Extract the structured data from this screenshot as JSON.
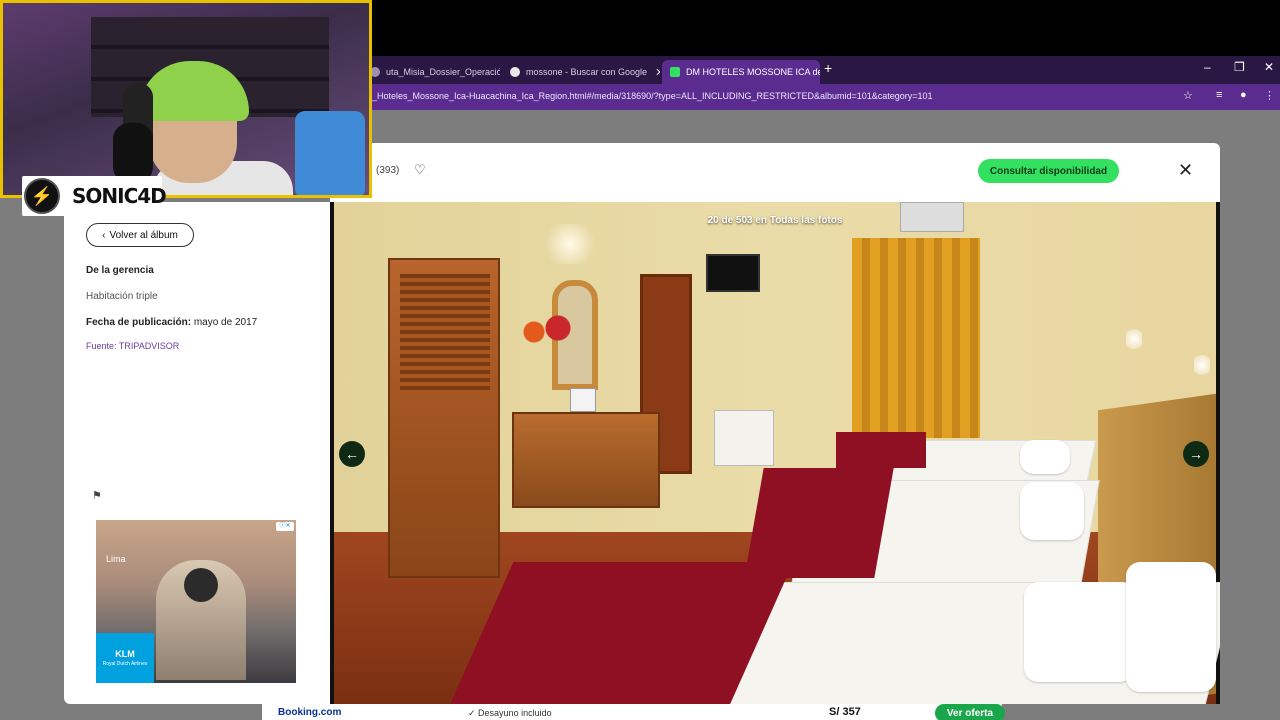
{
  "browser": {
    "tabs": [
      {
        "title": "uta_Misia_Dossier_Operación_",
        "icon_color": "#9a8fb0"
      },
      {
        "title": "mossone - Buscar con Google",
        "icon_color": "#e8e8e8"
      },
      {
        "title": "DM HOTELES MOSSONE ICA de",
        "icon_color": "#34e05f"
      }
    ],
    "new_tab": "+",
    "url": "_Hoteles_Mossone_Ica-Huacachina_Ica_Region.html#/media/318690/?type=ALL_INCLUDING_RESTRICTED&albumid=101&category=101"
  },
  "modal": {
    "rating_count": "(393)",
    "cta_label": "Consultar disponibilidad",
    "close_symbol": "✕",
    "back_label": "Volver al álbum",
    "owner": "De la gerencia",
    "caption": "Habitación triple",
    "date_label": "Fecha de publicación:",
    "date_value": "mayo de 2017",
    "source": "Fuente: TRIPADVISOR",
    "photo_counter": "20 de 503 en Todas las fotos"
  },
  "ad": {
    "city": "Lima",
    "brand": "KLM",
    "tagline": "Royal Dutch Airlines"
  },
  "offer_row": {
    "provider": "Booking.com",
    "amenity": "✓ Desayuno incluido",
    "price": "S/ 357",
    "button": "Ver oferta"
  },
  "overlay": {
    "channel": "SONIC4D"
  },
  "colors": {
    "cta": "#34e05f",
    "browser_tab_active": "#5b2c8f",
    "webcam_border": "#e8c200"
  }
}
